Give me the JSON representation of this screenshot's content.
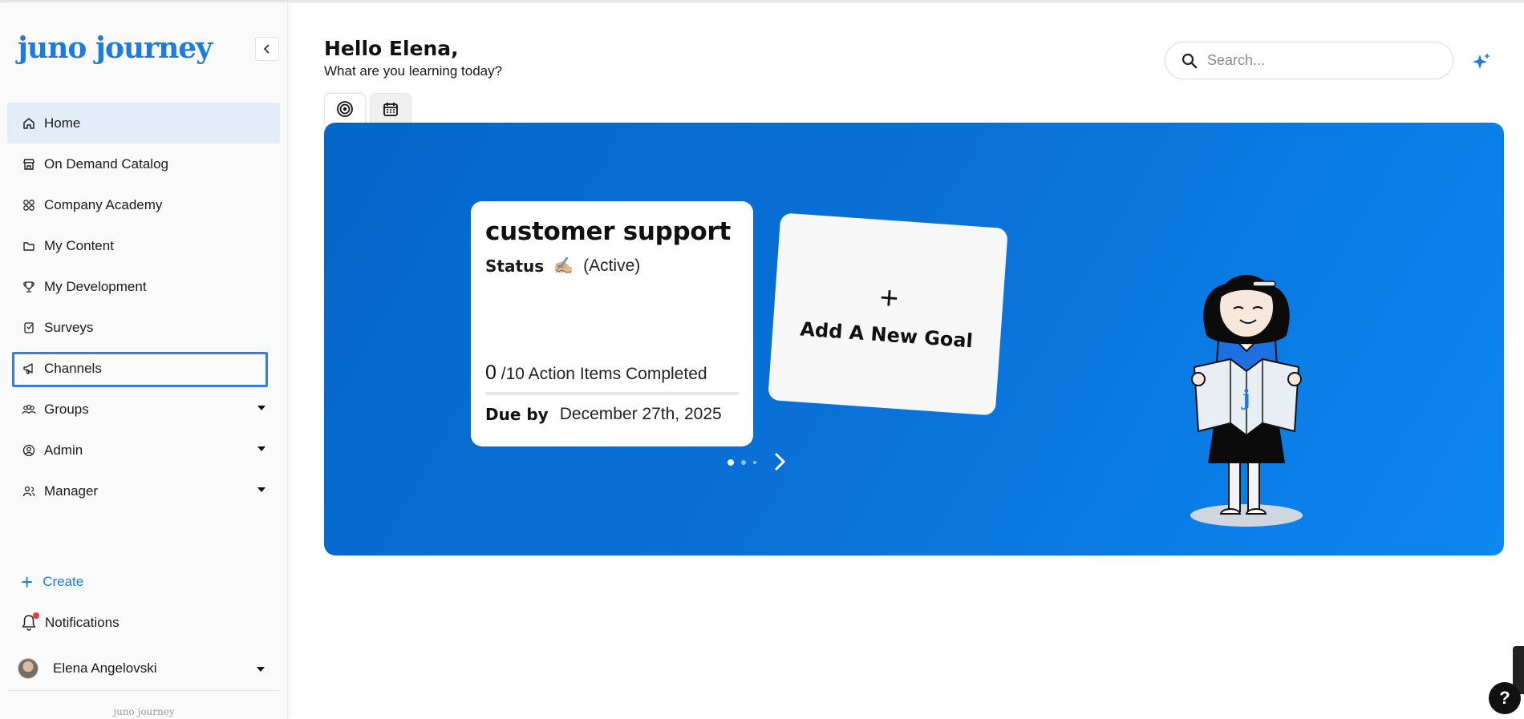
{
  "app": {
    "logo": "juno journey",
    "footer_logo": "juno journey"
  },
  "header": {
    "greeting": "Hello Elena,",
    "subtitle": "What are you learning today?"
  },
  "search": {
    "placeholder": "Search..."
  },
  "sidebar": {
    "items": [
      {
        "label": "Home",
        "icon": "home-icon"
      },
      {
        "label": "On Demand Catalog",
        "icon": "store-icon"
      },
      {
        "label": "Company Academy",
        "icon": "grid-icon"
      },
      {
        "label": "My Content",
        "icon": "folder-icon"
      },
      {
        "label": "My Development",
        "icon": "trophy-icon"
      },
      {
        "label": "Surveys",
        "icon": "survey-icon"
      },
      {
        "label": "Channels",
        "icon": "megaphone-icon"
      },
      {
        "label": "Groups",
        "icon": "group-icon"
      },
      {
        "label": "Admin",
        "icon": "admin-icon"
      },
      {
        "label": "Manager",
        "icon": "manager-icon"
      }
    ],
    "create_label": "Create",
    "notifications_label": "Notifications",
    "user_name": "Elena Angelovski"
  },
  "tabs": [
    {
      "icon": "target-icon"
    },
    {
      "icon": "calendar-icon"
    }
  ],
  "goal": {
    "title": "customer support",
    "status_label": "Status",
    "status_emoji": "✍🏼",
    "status_value": "(Active)",
    "completed": "0",
    "total_text": "/10 Action Items Completed",
    "progress_fraction": 0,
    "due_label": "Due by",
    "due_date": "December 27th, 2025"
  },
  "add_goal": {
    "plus": "+",
    "label": "Add A New Goal"
  },
  "carousel": {
    "pages": 3,
    "current": 1
  },
  "colors": {
    "accent": "#1c7be0",
    "banner_start": "#0566c9",
    "banner_end": "#0c86f2",
    "active_nav_bg": "#e3edf8",
    "notif_dot": "#e53950"
  }
}
